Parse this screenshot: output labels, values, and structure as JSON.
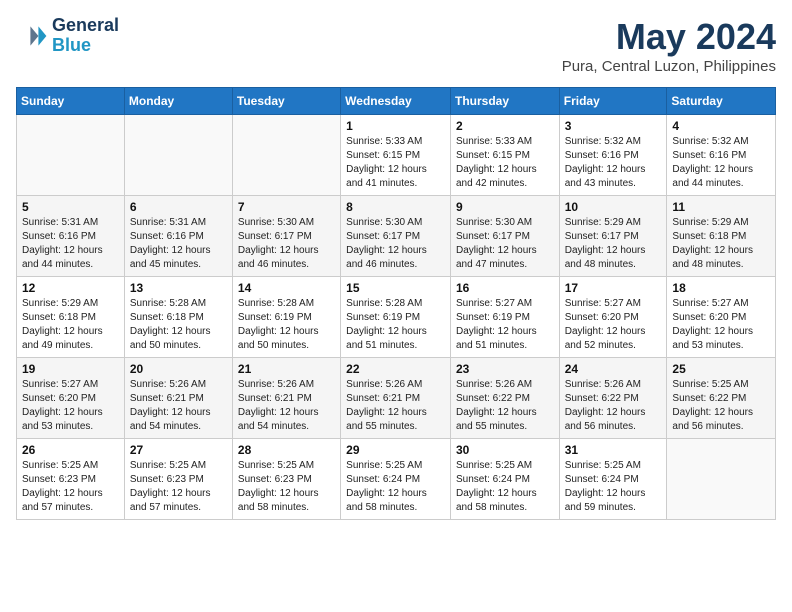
{
  "header": {
    "logo_line1": "General",
    "logo_line2": "Blue",
    "month_title": "May 2024",
    "subtitle": "Pura, Central Luzon, Philippines"
  },
  "days_of_week": [
    "Sunday",
    "Monday",
    "Tuesday",
    "Wednesday",
    "Thursday",
    "Friday",
    "Saturday"
  ],
  "weeks": [
    [
      {
        "day": "",
        "info": ""
      },
      {
        "day": "",
        "info": ""
      },
      {
        "day": "",
        "info": ""
      },
      {
        "day": "1",
        "info": "Sunrise: 5:33 AM\nSunset: 6:15 PM\nDaylight: 12 hours\nand 41 minutes."
      },
      {
        "day": "2",
        "info": "Sunrise: 5:33 AM\nSunset: 6:15 PM\nDaylight: 12 hours\nand 42 minutes."
      },
      {
        "day": "3",
        "info": "Sunrise: 5:32 AM\nSunset: 6:16 PM\nDaylight: 12 hours\nand 43 minutes."
      },
      {
        "day": "4",
        "info": "Sunrise: 5:32 AM\nSunset: 6:16 PM\nDaylight: 12 hours\nand 44 minutes."
      }
    ],
    [
      {
        "day": "5",
        "info": "Sunrise: 5:31 AM\nSunset: 6:16 PM\nDaylight: 12 hours\nand 44 minutes."
      },
      {
        "day": "6",
        "info": "Sunrise: 5:31 AM\nSunset: 6:16 PM\nDaylight: 12 hours\nand 45 minutes."
      },
      {
        "day": "7",
        "info": "Sunrise: 5:30 AM\nSunset: 6:17 PM\nDaylight: 12 hours\nand 46 minutes."
      },
      {
        "day": "8",
        "info": "Sunrise: 5:30 AM\nSunset: 6:17 PM\nDaylight: 12 hours\nand 46 minutes."
      },
      {
        "day": "9",
        "info": "Sunrise: 5:30 AM\nSunset: 6:17 PM\nDaylight: 12 hours\nand 47 minutes."
      },
      {
        "day": "10",
        "info": "Sunrise: 5:29 AM\nSunset: 6:17 PM\nDaylight: 12 hours\nand 48 minutes."
      },
      {
        "day": "11",
        "info": "Sunrise: 5:29 AM\nSunset: 6:18 PM\nDaylight: 12 hours\nand 48 minutes."
      }
    ],
    [
      {
        "day": "12",
        "info": "Sunrise: 5:29 AM\nSunset: 6:18 PM\nDaylight: 12 hours\nand 49 minutes."
      },
      {
        "day": "13",
        "info": "Sunrise: 5:28 AM\nSunset: 6:18 PM\nDaylight: 12 hours\nand 50 minutes."
      },
      {
        "day": "14",
        "info": "Sunrise: 5:28 AM\nSunset: 6:19 PM\nDaylight: 12 hours\nand 50 minutes."
      },
      {
        "day": "15",
        "info": "Sunrise: 5:28 AM\nSunset: 6:19 PM\nDaylight: 12 hours\nand 51 minutes."
      },
      {
        "day": "16",
        "info": "Sunrise: 5:27 AM\nSunset: 6:19 PM\nDaylight: 12 hours\nand 51 minutes."
      },
      {
        "day": "17",
        "info": "Sunrise: 5:27 AM\nSunset: 6:20 PM\nDaylight: 12 hours\nand 52 minutes."
      },
      {
        "day": "18",
        "info": "Sunrise: 5:27 AM\nSunset: 6:20 PM\nDaylight: 12 hours\nand 53 minutes."
      }
    ],
    [
      {
        "day": "19",
        "info": "Sunrise: 5:27 AM\nSunset: 6:20 PM\nDaylight: 12 hours\nand 53 minutes."
      },
      {
        "day": "20",
        "info": "Sunrise: 5:26 AM\nSunset: 6:21 PM\nDaylight: 12 hours\nand 54 minutes."
      },
      {
        "day": "21",
        "info": "Sunrise: 5:26 AM\nSunset: 6:21 PM\nDaylight: 12 hours\nand 54 minutes."
      },
      {
        "day": "22",
        "info": "Sunrise: 5:26 AM\nSunset: 6:21 PM\nDaylight: 12 hours\nand 55 minutes."
      },
      {
        "day": "23",
        "info": "Sunrise: 5:26 AM\nSunset: 6:22 PM\nDaylight: 12 hours\nand 55 minutes."
      },
      {
        "day": "24",
        "info": "Sunrise: 5:26 AM\nSunset: 6:22 PM\nDaylight: 12 hours\nand 56 minutes."
      },
      {
        "day": "25",
        "info": "Sunrise: 5:25 AM\nSunset: 6:22 PM\nDaylight: 12 hours\nand 56 minutes."
      }
    ],
    [
      {
        "day": "26",
        "info": "Sunrise: 5:25 AM\nSunset: 6:23 PM\nDaylight: 12 hours\nand 57 minutes."
      },
      {
        "day": "27",
        "info": "Sunrise: 5:25 AM\nSunset: 6:23 PM\nDaylight: 12 hours\nand 57 minutes."
      },
      {
        "day": "28",
        "info": "Sunrise: 5:25 AM\nSunset: 6:23 PM\nDaylight: 12 hours\nand 58 minutes."
      },
      {
        "day": "29",
        "info": "Sunrise: 5:25 AM\nSunset: 6:24 PM\nDaylight: 12 hours\nand 58 minutes."
      },
      {
        "day": "30",
        "info": "Sunrise: 5:25 AM\nSunset: 6:24 PM\nDaylight: 12 hours\nand 58 minutes."
      },
      {
        "day": "31",
        "info": "Sunrise: 5:25 AM\nSunset: 6:24 PM\nDaylight: 12 hours\nand 59 minutes."
      },
      {
        "day": "",
        "info": ""
      }
    ]
  ]
}
